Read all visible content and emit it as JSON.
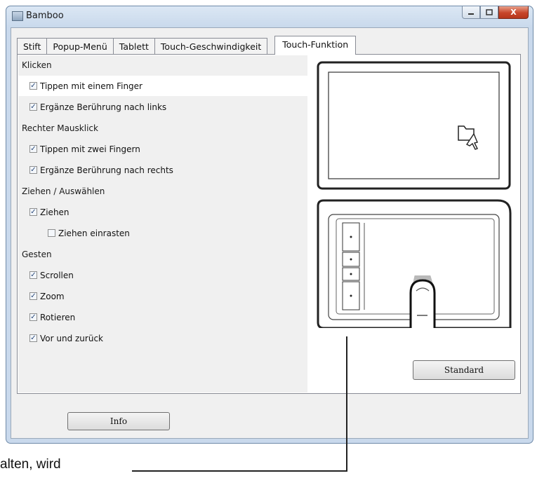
{
  "window": {
    "title": "Bamboo",
    "close_glyph": "X"
  },
  "tabs": [
    {
      "label": "Stift"
    },
    {
      "label": "Popup-Menü"
    },
    {
      "label": "Tablett"
    },
    {
      "label": "Touch-Geschwindigkeit"
    },
    {
      "label": "Touch-Funktion",
      "active": true
    }
  ],
  "sections": {
    "klicken": {
      "label": "Klicken",
      "options": [
        {
          "label": "Tippen mit einem Finger",
          "checked": true
        },
        {
          "label": "Ergänze Berührung nach links",
          "checked": true
        }
      ]
    },
    "rechter": {
      "label": "Rechter Mausklick",
      "options": [
        {
          "label": "Tippen mit zwei Fingern",
          "checked": true
        },
        {
          "label": "Ergänze Berührung nach rechts",
          "checked": true
        }
      ]
    },
    "ziehen": {
      "label": "Ziehen / Auswählen",
      "options": [
        {
          "label": "Ziehen",
          "checked": true
        },
        {
          "label": "Ziehen einrasten",
          "checked": false
        }
      ]
    },
    "gesten": {
      "label": "Gesten",
      "options": [
        {
          "label": "Scrollen",
          "checked": true
        },
        {
          "label": "Zoom",
          "checked": true
        },
        {
          "label": "Rotieren",
          "checked": true
        },
        {
          "label": "Vor und zurück",
          "checked": true
        }
      ]
    }
  },
  "buttons": {
    "standard": "Standard",
    "info": "Info"
  },
  "callout": {
    "text": "alten, wird"
  },
  "colors": {
    "window_frame": "#c9d9ec",
    "close_button": "#c7452a",
    "check_mark": "#2b4a7a"
  }
}
